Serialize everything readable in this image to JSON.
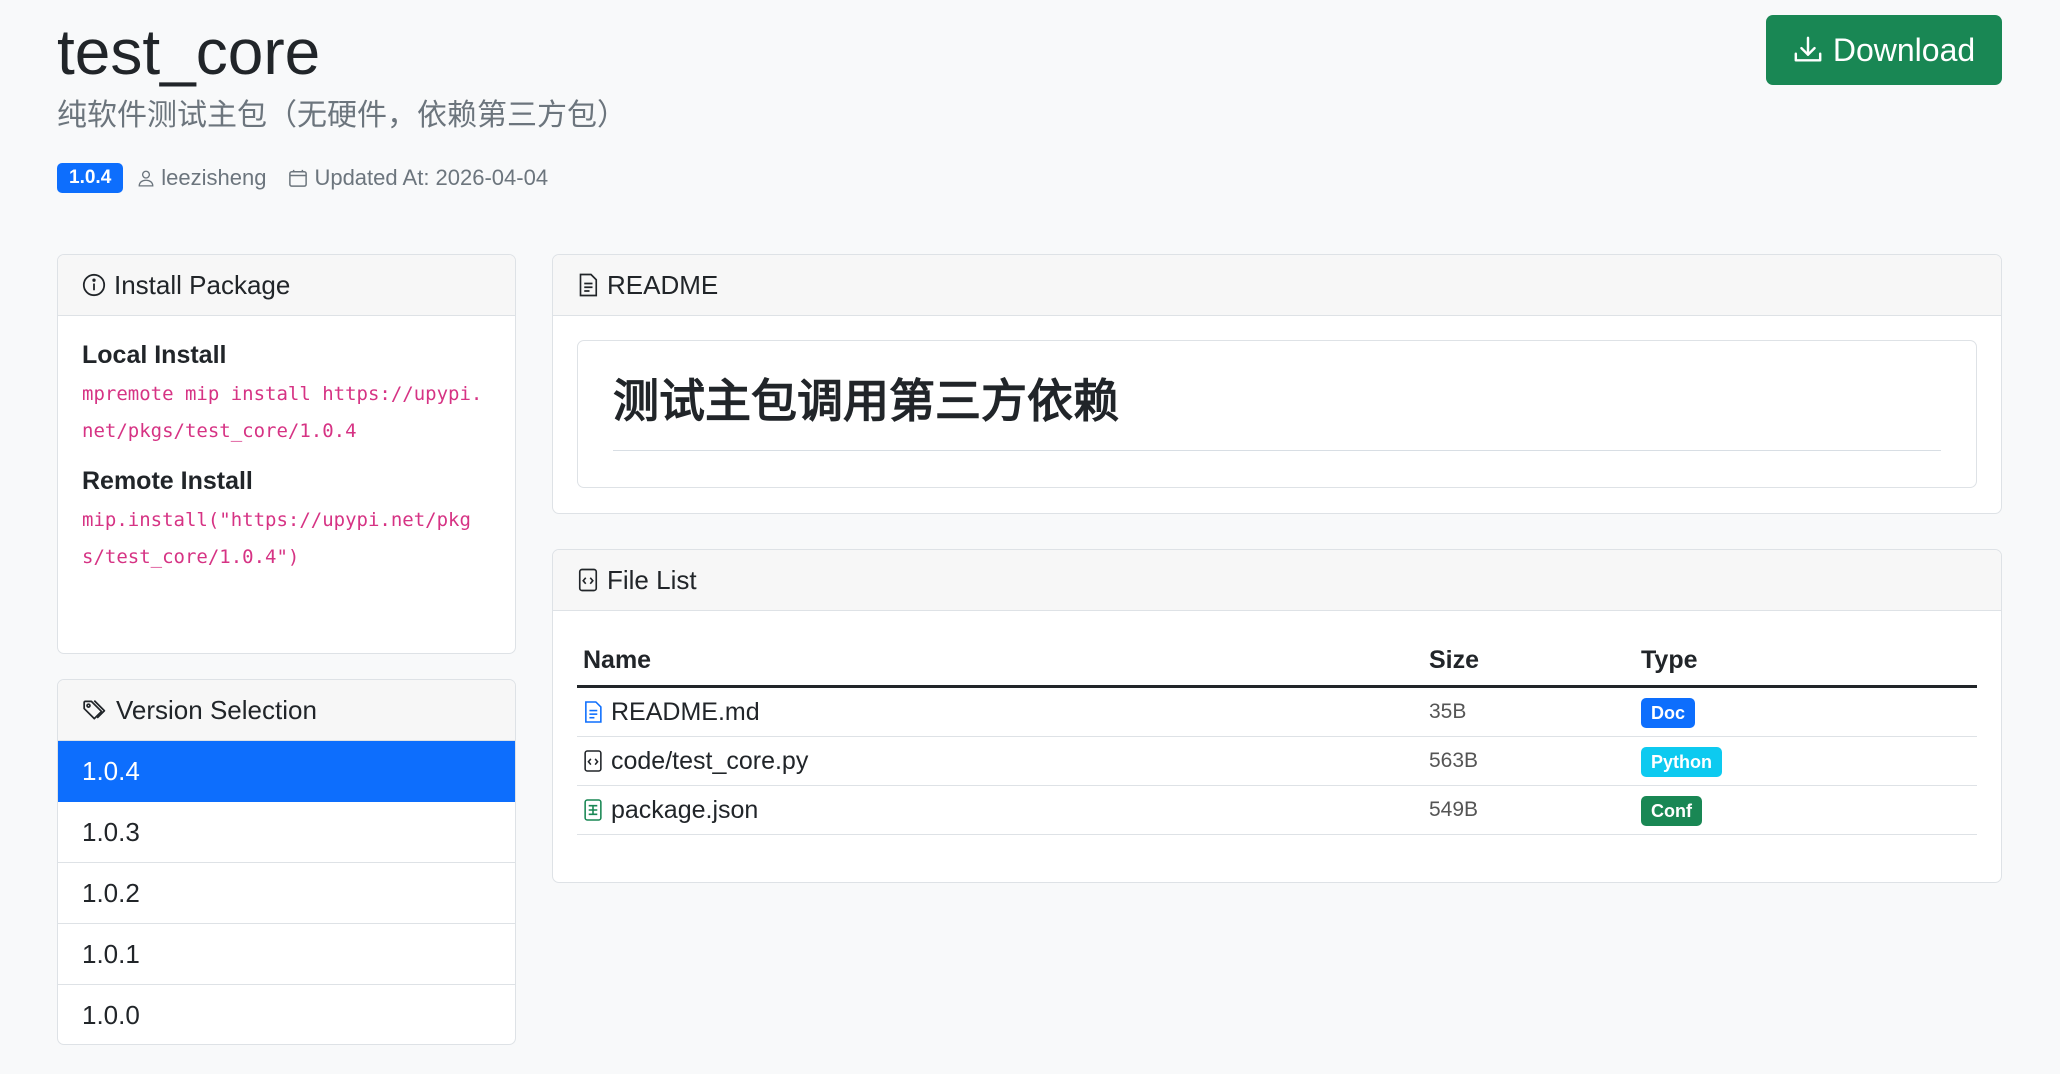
{
  "header": {
    "title": "test_core",
    "description": "纯软件测试主包（无硬件，依赖第三方包）",
    "version_badge": "1.0.4",
    "author": "leezisheng",
    "updated": "Updated At: 2026-04-04",
    "download_label": "Download"
  },
  "install": {
    "header": "Install Package",
    "local_title": "Local Install",
    "local_cmd": "mpremote mip install https://upypi.net/pkgs/test_core/1.0.4",
    "remote_title": "Remote Install",
    "remote_cmd": "mip.install(\"https://upypi.net/pkgs/test_core/1.0.4\")"
  },
  "versions": {
    "header": "Version Selection",
    "items": [
      {
        "label": "1.0.4",
        "active": true
      },
      {
        "label": "1.0.3",
        "active": false
      },
      {
        "label": "1.0.2",
        "active": false
      },
      {
        "label": "1.0.1",
        "active": false
      },
      {
        "label": "1.0.0",
        "active": false
      }
    ]
  },
  "readme": {
    "header": "README",
    "heading": "测试主包调用第三方依赖"
  },
  "files": {
    "header": "File List",
    "columns": [
      "Name",
      "Size",
      "Type"
    ],
    "rows": [
      {
        "name": "README.md",
        "size": "35B",
        "type": "Doc",
        "type_color": "#0d6efd",
        "icon": "file-text-icon",
        "icon_color": "#0d6efd"
      },
      {
        "name": "code/test_core.py",
        "size": "563B",
        "type": "Python",
        "type_color": "#0dcaf0",
        "icon": "file-code-icon",
        "icon_color": "#212529"
      },
      {
        "name": "package.json",
        "size": "549B",
        "type": "Conf",
        "type_color": "#198754",
        "icon": "file-spreadsheet-icon",
        "icon_color": "#198754"
      }
    ]
  },
  "colors": {
    "primary": "#0d6efd",
    "success": "#198754",
    "info": "#0dcaf0",
    "code": "#d63384"
  }
}
